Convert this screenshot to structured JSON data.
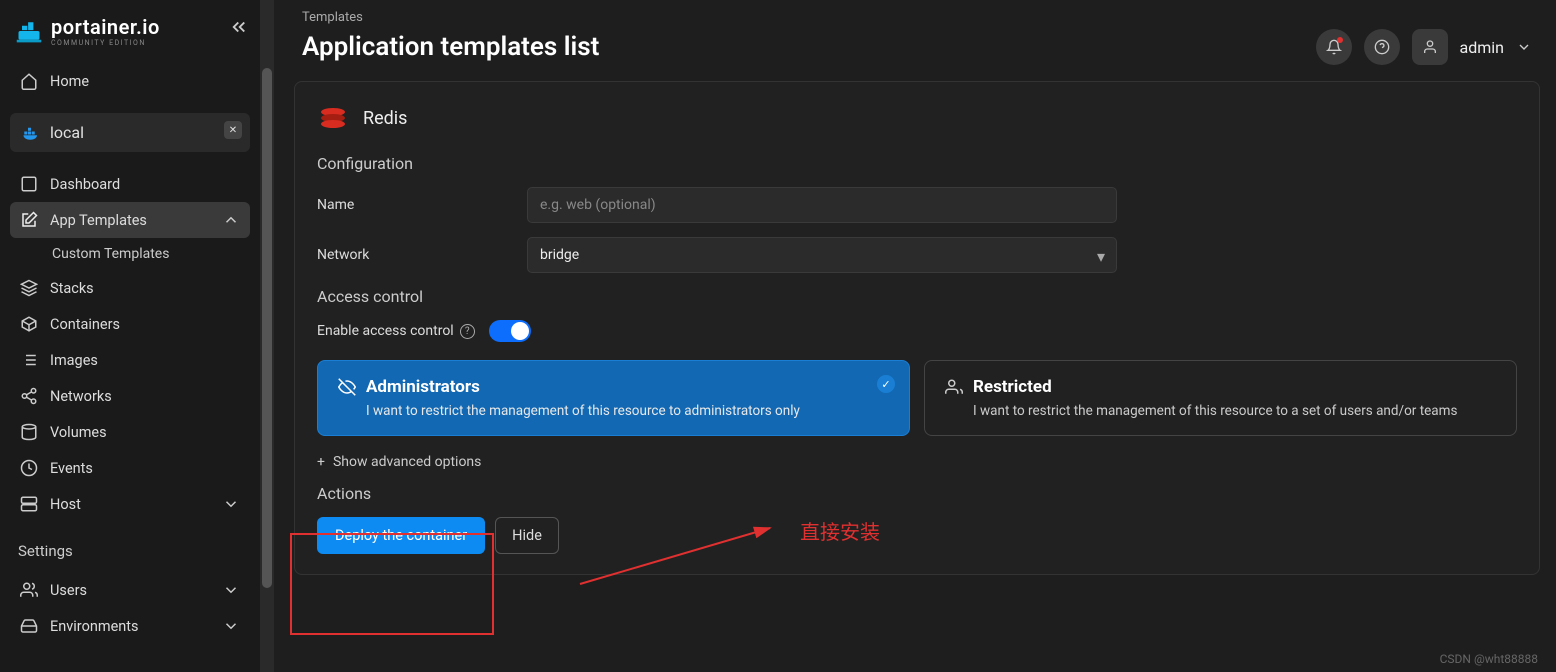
{
  "brand": {
    "name": "portainer.io",
    "edition": "COMMUNITY EDITION"
  },
  "nav": {
    "home": "Home",
    "env": "local",
    "items": {
      "dashboard": "Dashboard",
      "app_templates": "App Templates",
      "custom_templates": "Custom Templates",
      "stacks": "Stacks",
      "containers": "Containers",
      "images": "Images",
      "networks": "Networks",
      "volumes": "Volumes",
      "events": "Events",
      "host": "Host"
    },
    "settings_label": "Settings",
    "settings": {
      "users": "Users",
      "environments": "Environments"
    }
  },
  "header": {
    "breadcrumb": "Templates",
    "title": "Application templates list",
    "user": "admin"
  },
  "template": {
    "name": "Redis",
    "config_title": "Configuration",
    "name_label": "Name",
    "name_placeholder": "e.g. web (optional)",
    "network_label": "Network",
    "network_value": "bridge",
    "access_title": "Access control",
    "enable_label": "Enable access control",
    "admins": {
      "title": "Administrators",
      "desc": "I want to restrict the management of this resource to administrators only"
    },
    "restricted": {
      "title": "Restricted",
      "desc": "I want to restrict the management of this resource to a set of users and/or teams"
    },
    "advanced": "Show advanced options",
    "actions_title": "Actions",
    "deploy": "Deploy the container",
    "hide": "Hide"
  },
  "annotation": {
    "text": "直接安装"
  },
  "watermark": "CSDN @wht88888"
}
